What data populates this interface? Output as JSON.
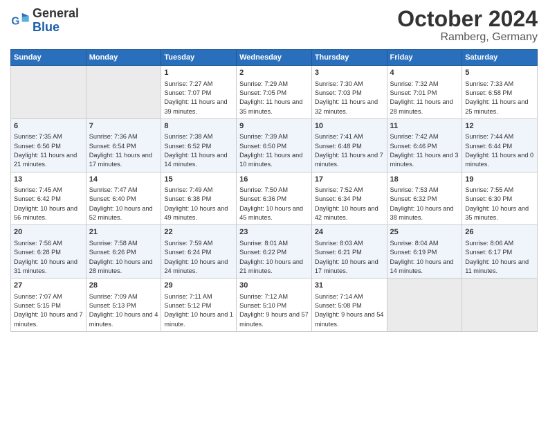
{
  "header": {
    "logo_text_general": "General",
    "logo_text_blue": "Blue",
    "month_title": "October 2024",
    "location": "Ramberg, Germany"
  },
  "days_of_week": [
    "Sunday",
    "Monday",
    "Tuesday",
    "Wednesday",
    "Thursday",
    "Friday",
    "Saturday"
  ],
  "weeks": [
    [
      {
        "day": "",
        "empty": true
      },
      {
        "day": "",
        "empty": true
      },
      {
        "day": "1",
        "sunrise": "7:27 AM",
        "sunset": "7:07 PM",
        "daylight": "11 hours and 39 minutes."
      },
      {
        "day": "2",
        "sunrise": "7:29 AM",
        "sunset": "7:05 PM",
        "daylight": "11 hours and 35 minutes."
      },
      {
        "day": "3",
        "sunrise": "7:30 AM",
        "sunset": "7:03 PM",
        "daylight": "11 hours and 32 minutes."
      },
      {
        "day": "4",
        "sunrise": "7:32 AM",
        "sunset": "7:01 PM",
        "daylight": "11 hours and 28 minutes."
      },
      {
        "day": "5",
        "sunrise": "7:33 AM",
        "sunset": "6:58 PM",
        "daylight": "11 hours and 25 minutes."
      }
    ],
    [
      {
        "day": "6",
        "sunrise": "7:35 AM",
        "sunset": "6:56 PM",
        "daylight": "11 hours and 21 minutes."
      },
      {
        "day": "7",
        "sunrise": "7:36 AM",
        "sunset": "6:54 PM",
        "daylight": "11 hours and 17 minutes."
      },
      {
        "day": "8",
        "sunrise": "7:38 AM",
        "sunset": "6:52 PM",
        "daylight": "11 hours and 14 minutes."
      },
      {
        "day": "9",
        "sunrise": "7:39 AM",
        "sunset": "6:50 PM",
        "daylight": "11 hours and 10 minutes."
      },
      {
        "day": "10",
        "sunrise": "7:41 AM",
        "sunset": "6:48 PM",
        "daylight": "11 hours and 7 minutes."
      },
      {
        "day": "11",
        "sunrise": "7:42 AM",
        "sunset": "6:46 PM",
        "daylight": "11 hours and 3 minutes."
      },
      {
        "day": "12",
        "sunrise": "7:44 AM",
        "sunset": "6:44 PM",
        "daylight": "11 hours and 0 minutes."
      }
    ],
    [
      {
        "day": "13",
        "sunrise": "7:45 AM",
        "sunset": "6:42 PM",
        "daylight": "10 hours and 56 minutes."
      },
      {
        "day": "14",
        "sunrise": "7:47 AM",
        "sunset": "6:40 PM",
        "daylight": "10 hours and 52 minutes."
      },
      {
        "day": "15",
        "sunrise": "7:49 AM",
        "sunset": "6:38 PM",
        "daylight": "10 hours and 49 minutes."
      },
      {
        "day": "16",
        "sunrise": "7:50 AM",
        "sunset": "6:36 PM",
        "daylight": "10 hours and 45 minutes."
      },
      {
        "day": "17",
        "sunrise": "7:52 AM",
        "sunset": "6:34 PM",
        "daylight": "10 hours and 42 minutes."
      },
      {
        "day": "18",
        "sunrise": "7:53 AM",
        "sunset": "6:32 PM",
        "daylight": "10 hours and 38 minutes."
      },
      {
        "day": "19",
        "sunrise": "7:55 AM",
        "sunset": "6:30 PM",
        "daylight": "10 hours and 35 minutes."
      }
    ],
    [
      {
        "day": "20",
        "sunrise": "7:56 AM",
        "sunset": "6:28 PM",
        "daylight": "10 hours and 31 minutes."
      },
      {
        "day": "21",
        "sunrise": "7:58 AM",
        "sunset": "6:26 PM",
        "daylight": "10 hours and 28 minutes."
      },
      {
        "day": "22",
        "sunrise": "7:59 AM",
        "sunset": "6:24 PM",
        "daylight": "10 hours and 24 minutes."
      },
      {
        "day": "23",
        "sunrise": "8:01 AM",
        "sunset": "6:22 PM",
        "daylight": "10 hours and 21 minutes."
      },
      {
        "day": "24",
        "sunrise": "8:03 AM",
        "sunset": "6:21 PM",
        "daylight": "10 hours and 17 minutes."
      },
      {
        "day": "25",
        "sunrise": "8:04 AM",
        "sunset": "6:19 PM",
        "daylight": "10 hours and 14 minutes."
      },
      {
        "day": "26",
        "sunrise": "8:06 AM",
        "sunset": "6:17 PM",
        "daylight": "10 hours and 11 minutes."
      }
    ],
    [
      {
        "day": "27",
        "sunrise": "7:07 AM",
        "sunset": "5:15 PM",
        "daylight": "10 hours and 7 minutes."
      },
      {
        "day": "28",
        "sunrise": "7:09 AM",
        "sunset": "5:13 PM",
        "daylight": "10 hours and 4 minutes."
      },
      {
        "day": "29",
        "sunrise": "7:11 AM",
        "sunset": "5:12 PM",
        "daylight": "10 hours and 1 minute."
      },
      {
        "day": "30",
        "sunrise": "7:12 AM",
        "sunset": "5:10 PM",
        "daylight": "9 hours and 57 minutes."
      },
      {
        "day": "31",
        "sunrise": "7:14 AM",
        "sunset": "5:08 PM",
        "daylight": "9 hours and 54 minutes."
      },
      {
        "day": "",
        "empty": true
      },
      {
        "day": "",
        "empty": true
      }
    ]
  ]
}
